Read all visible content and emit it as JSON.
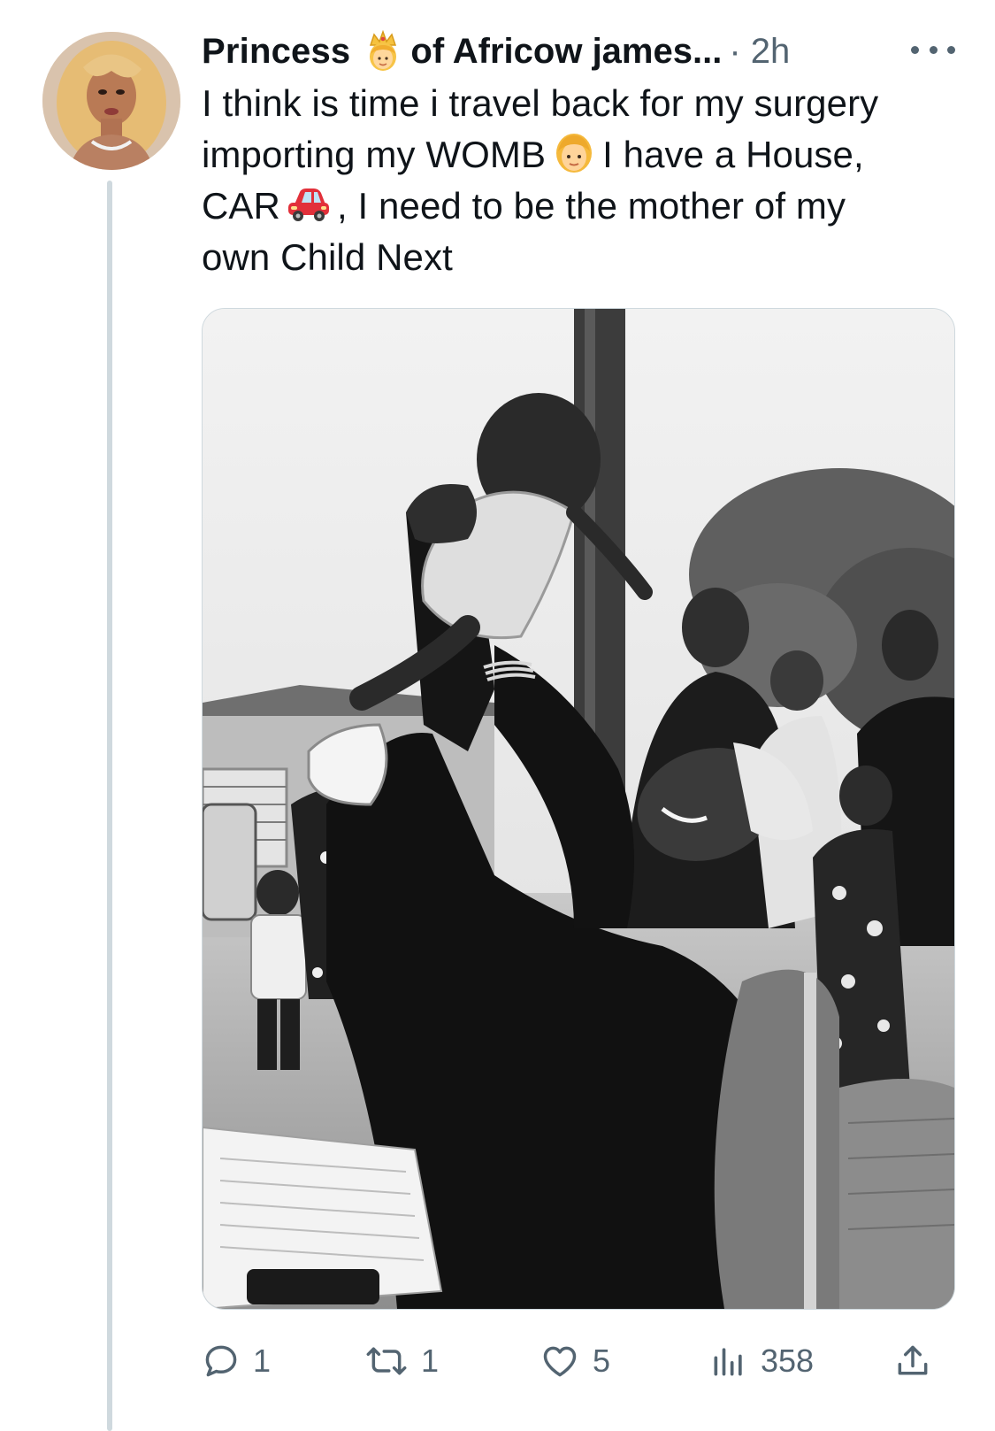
{
  "tweet": {
    "author": {
      "display_name_part1": "Princess",
      "display_name_icon": "princess-crown-emoji",
      "display_name_part2": "of Africow james...",
      "avatar_icon": "profile-avatar"
    },
    "timestamp": "· 2h",
    "text_lines": [
      "I think is time i travel back for my surgery",
      "importing my WOMB",
      "I have a House,",
      "CAR",
      ", I need to be the mother of my",
      "own Child Next"
    ],
    "inline_emojis": [
      "woman-emoji",
      "red-car-emoji"
    ],
    "media": {
      "type": "photo",
      "style": "black-and-white"
    },
    "metrics": {
      "replies": "1",
      "reposts": "1",
      "likes": "5",
      "views": "358"
    }
  },
  "icons": {
    "reply": "reply-icon",
    "repost": "repost-icon",
    "like": "heart-icon",
    "views": "views-bar-chart-icon",
    "share": "share-icon",
    "more": "more-dots-icon"
  },
  "colors": {
    "text": "#0f1419",
    "secondary_text": "#536471",
    "thread_line": "#cfd9de"
  }
}
